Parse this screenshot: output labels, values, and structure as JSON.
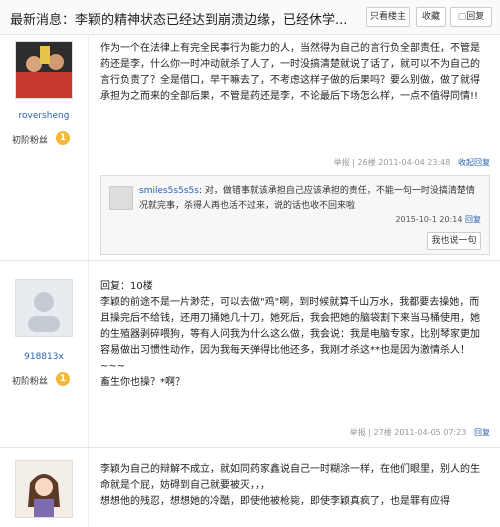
{
  "topbar": {
    "title": "最新消息：李颖的精神状态已经达到崩溃边缘，已经休学...",
    "buttons": [
      "只看楼主",
      "收藏",
      "回复"
    ]
  },
  "posts": [
    {
      "username": "roversheng",
      "rank": "初阶粉丝",
      "level": "1",
      "text": "作为一个在法律上有完全民事行为能力的人，当然得为自己的言行负全部责任，不管是药还是李，什么你一时冲动就杀了人了，一时没搞清楚就说了话了，就可以不为自己的言行负责了？全是借口，早干嘛去了，不考虑这样子做的后果吗？要么别做，做了就得承担为之而来的全部后果，不管是药还是李，不论最后下场怎么样，一点不值得同情!!",
      "meta": {
        "report": "举报",
        "floor": "26楼",
        "time": "2011-04-04 23:48",
        "reply": "收起回复"
      },
      "reply": {
        "user": "smiles5s5s5s",
        "text": "对，做错事就该承担自己应该承担的责任，不能一句一时没搞清楚情况就完事，杀得人再也活不过来，说的话也收不回来啦",
        "time": "2015-10-1 20:14",
        "reply_link": "回复",
        "say_button": "我也说一句"
      }
    },
    {
      "username": "918813x",
      "rank": "初阶粉丝",
      "level": "1",
      "text_lines": [
        "回复：10楼",
        "李颖的前途不是一片渺茫，可以去做\"鸡\"啊，到时候就算千山万水，我都要去操她，而且操完后不给钱，还用刀捅她几十刀，她死后，我会把她的脑袋割下来当马桶使用，她的生殖器剥碎喂狗，等有人问我为什么这么做，我会说：我是电脑专家，比别琴家更加容易做出习惯性动作，因为我每天弹得比他还多，我刚才杀这**也是因为激情杀人！",
        "~~~",
        "畜生你也操？*啊？"
      ],
      "meta": {
        "report": "举报",
        "floor": "27楼",
        "time": "2011-04-05 07:23",
        "reply": "回复"
      }
    },
    {
      "username": "",
      "text_lines": [
        "李颖为自己的辩解不成立，就如同药家鑫说自己一时糊涂一样，在他们眼里，别人的生命就是个屁，妨碍到自己就要被灭，，，",
        "想想他的残忍，想想她的冷酷，即使他被枪毙，即使李颖真疯了，也是罪有应得"
      ]
    }
  ],
  "colors": {
    "link": "#2a62b0",
    "badge": "#f3b83c"
  }
}
